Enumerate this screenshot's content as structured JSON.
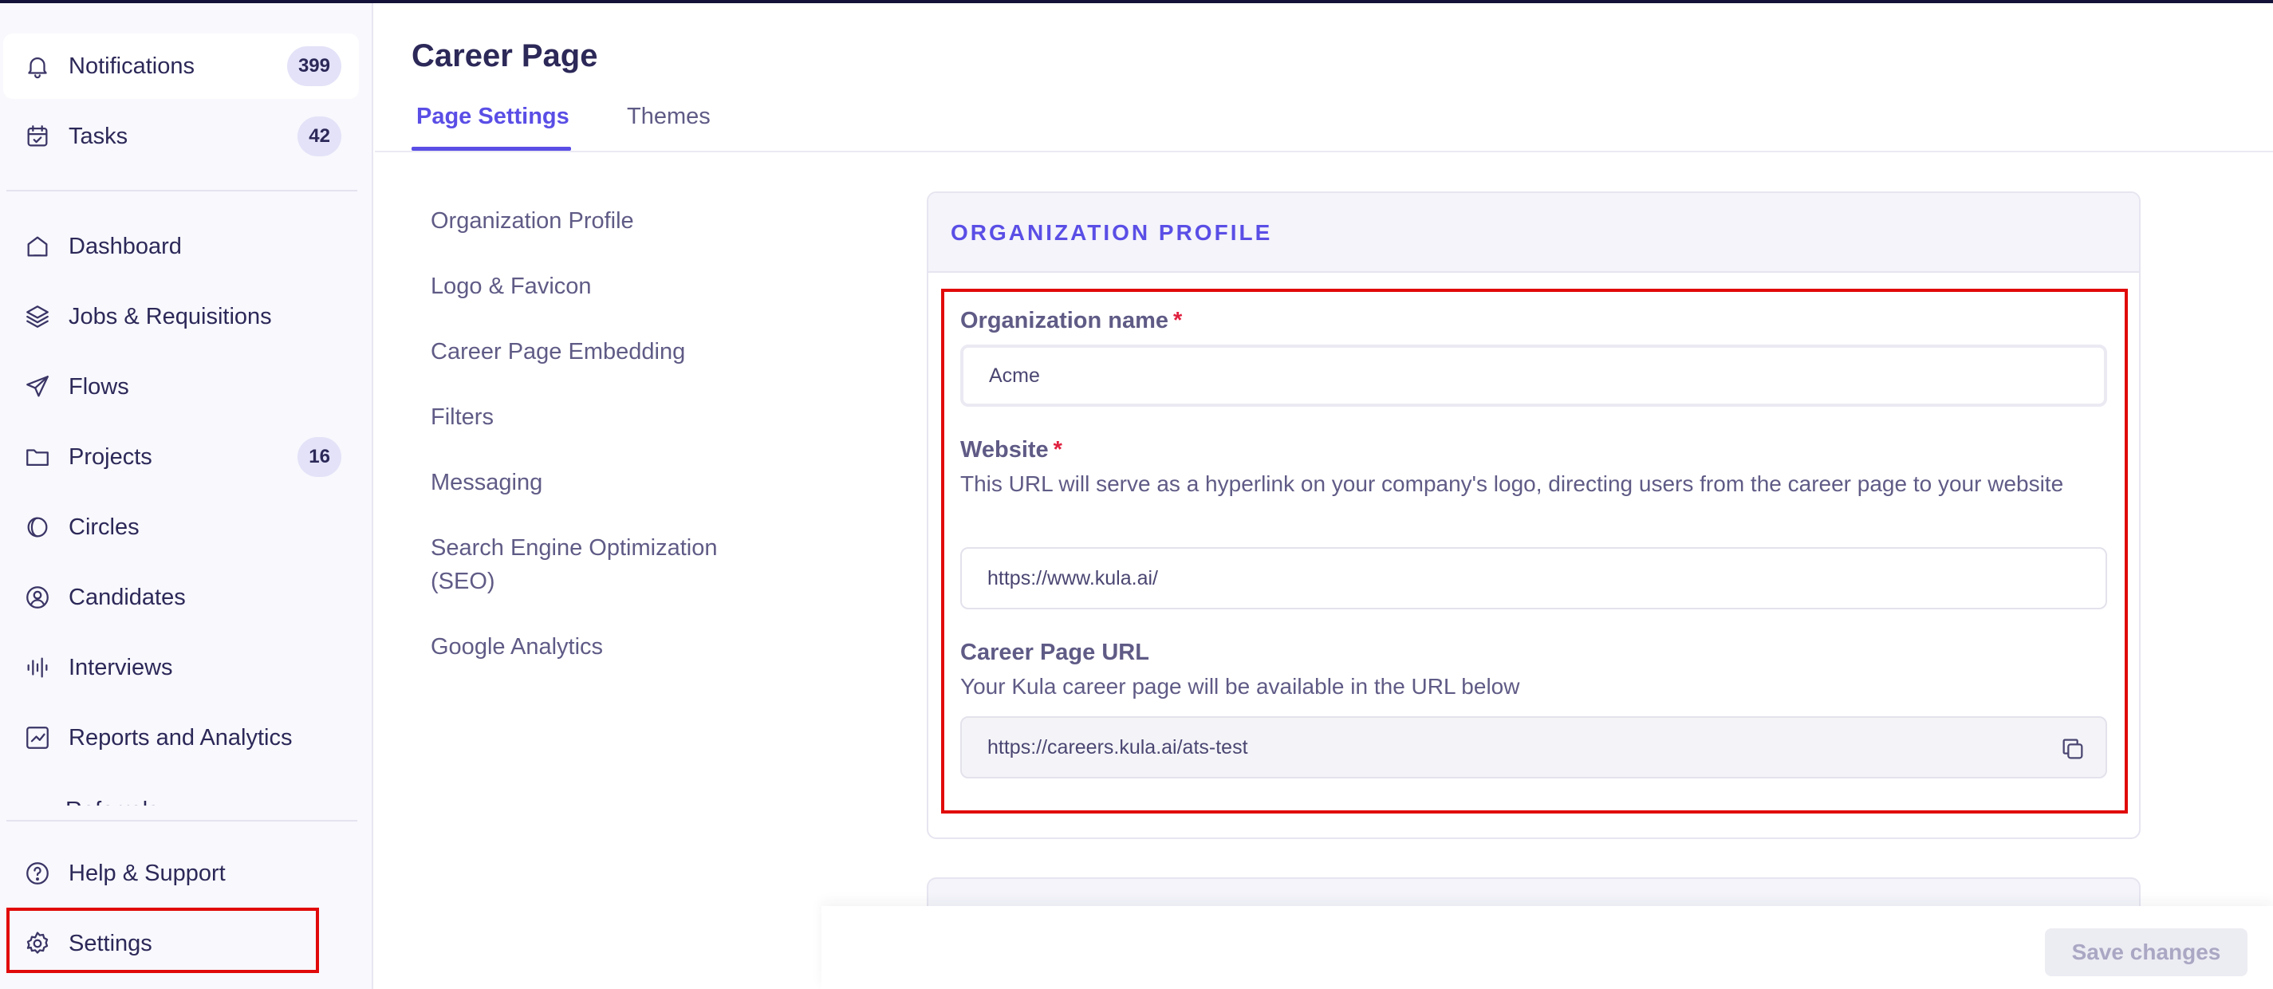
{
  "sidebar": {
    "top": [
      {
        "label": "Notifications",
        "badge": "399",
        "icon": "bell-icon"
      },
      {
        "label": "Tasks",
        "badge": "42",
        "icon": "calendar-check-icon"
      }
    ],
    "items": [
      {
        "label": "Dashboard",
        "icon": "home-icon"
      },
      {
        "label": "Jobs & Requisitions",
        "icon": "layers-icon"
      },
      {
        "label": "Flows",
        "icon": "send-icon"
      },
      {
        "label": "Projects",
        "badge": "16",
        "icon": "folder-icon"
      },
      {
        "label": "Circles",
        "icon": "circles-icon"
      },
      {
        "label": "Candidates",
        "icon": "user-circle-icon"
      },
      {
        "label": "Interviews",
        "icon": "audio-wave-icon"
      },
      {
        "label": "Reports and Analytics",
        "icon": "chart-icon"
      }
    ],
    "clipped_label": "Referrals",
    "bottom": [
      {
        "label": "Help & Support",
        "icon": "question-icon"
      },
      {
        "label": "Settings",
        "icon": "gear-icon"
      }
    ]
  },
  "header": {
    "title": "Career Page",
    "tabs": [
      "Page Settings",
      "Themes"
    ]
  },
  "subnav": [
    "Organization Profile",
    "Logo & Favicon",
    "Career Page Embedding",
    "Filters",
    "Messaging",
    "Search Engine Optimization (SEO)",
    "Google Analytics"
  ],
  "card": {
    "title": "ORGANIZATION PROFILE",
    "org_name": {
      "label": "Organization name",
      "required": "*",
      "value": "Acme"
    },
    "website": {
      "label": "Website",
      "required": "*",
      "help": "This URL will serve as a hyperlink on your company's logo, directing users from the career page to your website",
      "value": "https://www.kula.ai/"
    },
    "career_url": {
      "label": "Career Page URL",
      "help": "Your Kula career page will be available in the URL below",
      "value": "https://careers.kula.ai/ats-test"
    }
  },
  "footer": {
    "save_label": "Save changes"
  },
  "colors": {
    "accent": "#5a4ee6",
    "highlight": "#e10a0a",
    "required": "#e0203e"
  }
}
